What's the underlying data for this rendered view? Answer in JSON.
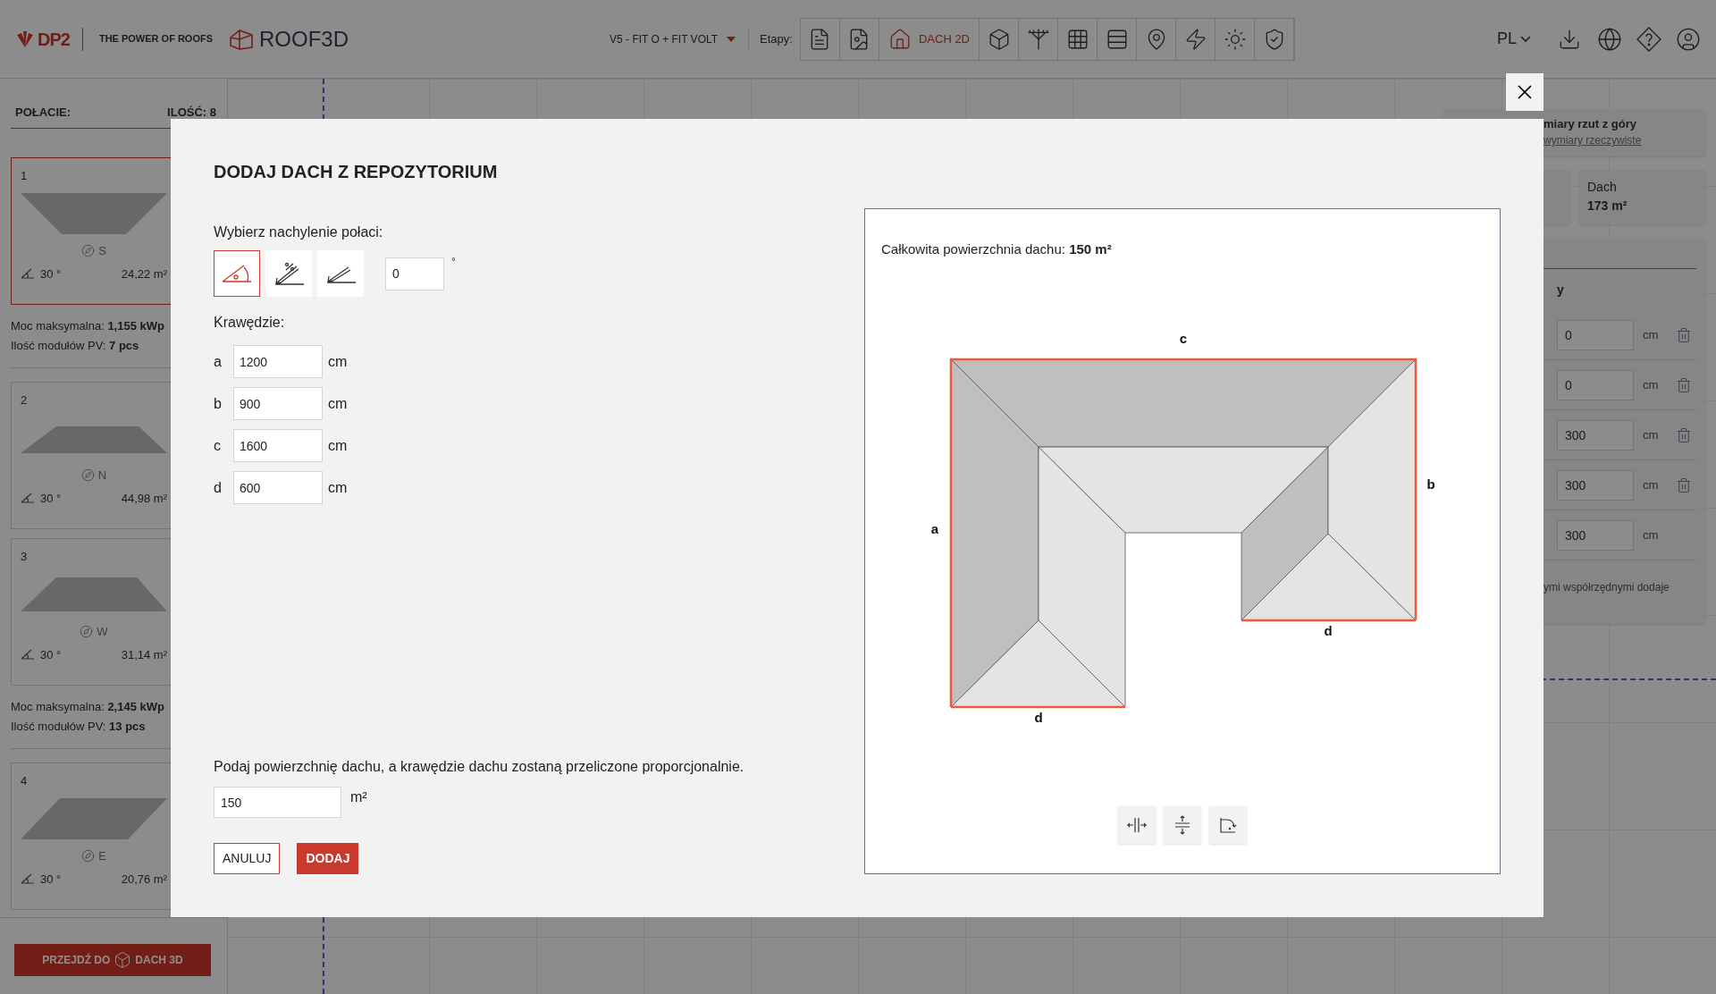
{
  "header": {
    "logo_text": "DP2",
    "tagline": "THE POWER OF ROOFS",
    "product": "ROOF3D",
    "project": "V5 - FIT O + FIT VOLT",
    "stages_label": "Etapy:",
    "stages": [
      {
        "selected": false
      },
      {
        "selected": false
      },
      {
        "label": "DACH 2D",
        "selected": true
      },
      {
        "selected": false
      },
      {
        "selected": false
      },
      {
        "selected": false
      },
      {
        "selected": false
      },
      {
        "selected": false
      },
      {
        "selected": false
      },
      {
        "selected": false
      },
      {
        "selected": false
      }
    ],
    "language": "PL"
  },
  "sidebar": {
    "title": "POŁACIE:",
    "count": "ILOŚĆ: 8",
    "items": [
      {
        "kind": "plane",
        "number": "1",
        "direction": "S",
        "angle": "30 °",
        "area": "24,22 m²",
        "selected": true
      },
      {
        "kind": "summary",
        "power": "Moc maksymalna: **1,155 kWp**",
        "modules": "Ilość modułów PV: **7 pcs**"
      },
      {
        "kind": "plane",
        "number": "2",
        "direction": "N",
        "angle": "30 °",
        "area": "44,98 m²",
        "selected": false
      },
      {
        "kind": "plane",
        "number": "3",
        "direction": "W",
        "angle": "30 °",
        "area": "31,14 m²",
        "selected": false
      },
      {
        "kind": "summary",
        "power": "Moc maksymalna: **2,145 kWp**",
        "modules": "Ilość modułów PV: **13 pcs**"
      },
      {
        "kind": "plane",
        "number": "4",
        "direction": "E",
        "angle": "30 °",
        "area": "20,76 m²",
        "selected": false
      }
    ],
    "action": "PRZEJDŹ DO",
    "action_target": "DACH 3D"
  },
  "right_panel": {
    "mode_text": "miary rzut z góry",
    "mode_link": "wymiary rzeczywiste",
    "stat_label": "Dach",
    "stat_value": "173 m²",
    "column": "y",
    "rows": [
      {
        "value": "0",
        "unit": "cm",
        "deletable": true
      },
      {
        "value": "0",
        "unit": "cm",
        "deletable": true
      },
      {
        "value": "300",
        "unit": "cm",
        "deletable": true
      },
      {
        "value": "300",
        "unit": "cm",
        "deletable": true
      },
      {
        "value": "300",
        "unit": "cm",
        "deletable": false
      }
    ],
    "note": "ymi współrzędnymi dodaje"
  },
  "dialog": {
    "title": "DODAJ DACH Z REPOZYTORIUM",
    "slope_label": "Wybierz nachylenie połaci:",
    "slope_modes": [
      {
        "selected": true
      },
      {
        "selected": false
      },
      {
        "selected": false
      }
    ],
    "slope_value": "0",
    "slope_unit": "°",
    "edges_label": "Krawędzie:",
    "edges": [
      {
        "name": "a",
        "value": "1200",
        "unit": "cm"
      },
      {
        "name": "b",
        "value": "900",
        "unit": "cm"
      },
      {
        "name": "c",
        "value": "1600",
        "unit": "cm"
      },
      {
        "name": "d",
        "value": "600",
        "unit": "cm"
      }
    ],
    "area_hint": "Podaj powierzchnię dachu, a krawędzie dachu zostaną przeliczone proporcjonalnie.",
    "area_value": "150",
    "area_unit": "m²",
    "buttons": [
      {
        "label": "ANULUJ",
        "kind": "secondary"
      },
      {
        "label": "DODAJ",
        "kind": "primary"
      }
    ],
    "preview": {
      "total": "Całkowita powierzchnia dachu: **150 m²**",
      "edge_labels": [
        "c",
        "b",
        "a",
        "d",
        "d"
      ]
    }
  }
}
